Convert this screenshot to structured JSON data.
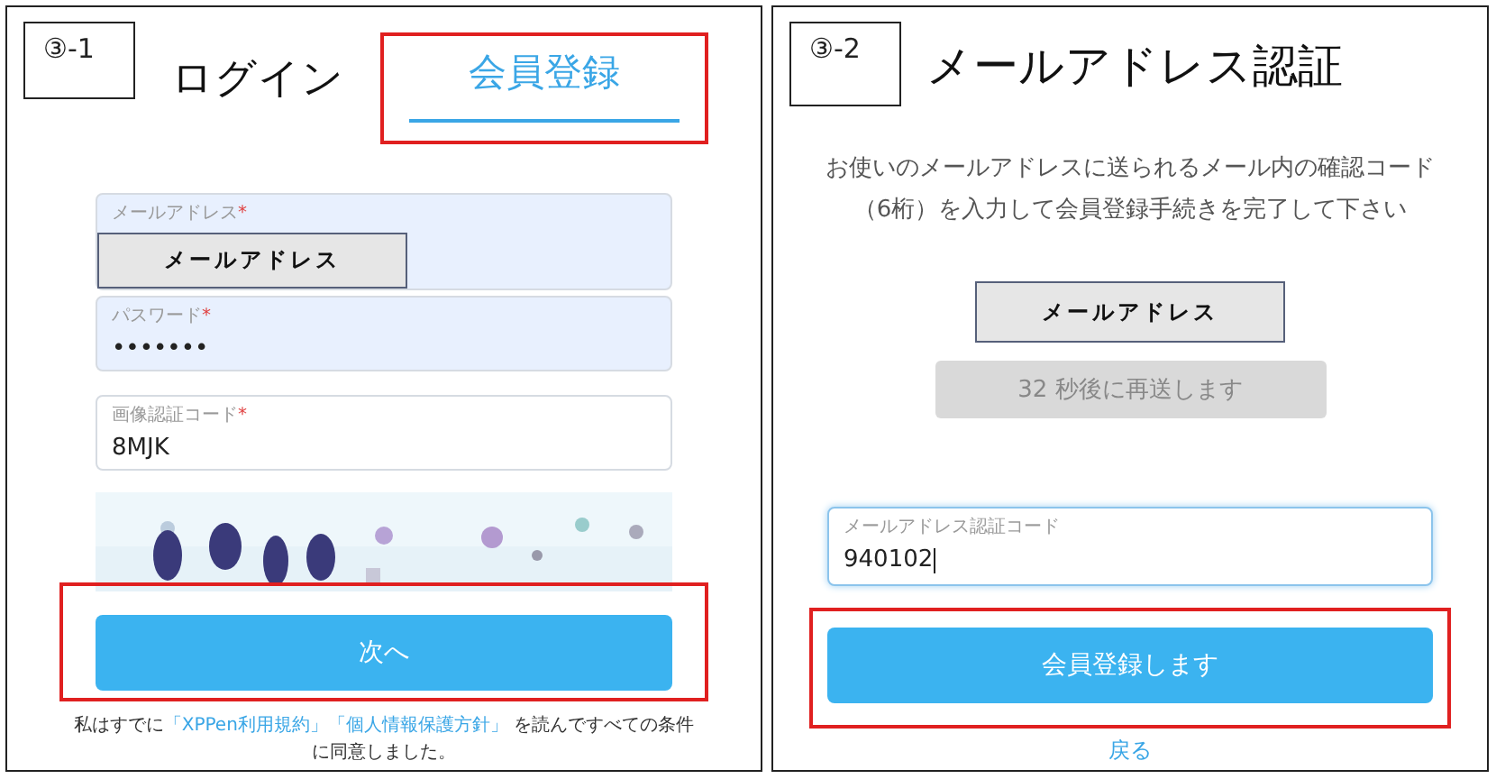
{
  "login_panel": {
    "step": "③-1",
    "tabs": [
      {
        "label": "ログイン",
        "selected": false,
        "highlighted": false
      },
      {
        "label": "会員登録",
        "selected": true,
        "highlighted": true
      }
    ],
    "fields": [
      {
        "label": "メールアドレス",
        "required_mark": "*",
        "autofilled": true,
        "redaction": "メールアドレス"
      },
      {
        "label": "パスワード",
        "required_mark": "*",
        "autofilled": true,
        "value": "•••••••"
      },
      {
        "label": "画像認証コード",
        "required_mark": "*",
        "autofilled": false,
        "value": "8MJK"
      }
    ],
    "submit": {
      "label": "次へ",
      "highlighted": true
    },
    "agreement": [
      {
        "kind": "plain",
        "text": "私はすでに"
      },
      {
        "kind": "link",
        "text": "「XPPen利用規約」"
      },
      {
        "kind": "link",
        "text": "「個人情報保護方針」"
      },
      {
        "kind": "plain",
        "text": " を読んですべての条件に同意しました。"
      }
    ]
  },
  "verify_panel": {
    "step": "③-2",
    "title": "メールアドレス認証",
    "instructions": "お使いのメールアドレスに送られるメール内の確認コード（6桁）を入力して会員登録手続きを完了して下さい",
    "email_redaction": "メールアドレス",
    "resend": {
      "label": "32 秒後に再送します",
      "disabled": true
    },
    "code_field": {
      "label": "メールアドレス認証コード",
      "value": "940102",
      "focused": true
    },
    "submit": {
      "label": "会員登録します",
      "highlighted": true
    },
    "back_link": "戻る"
  }
}
